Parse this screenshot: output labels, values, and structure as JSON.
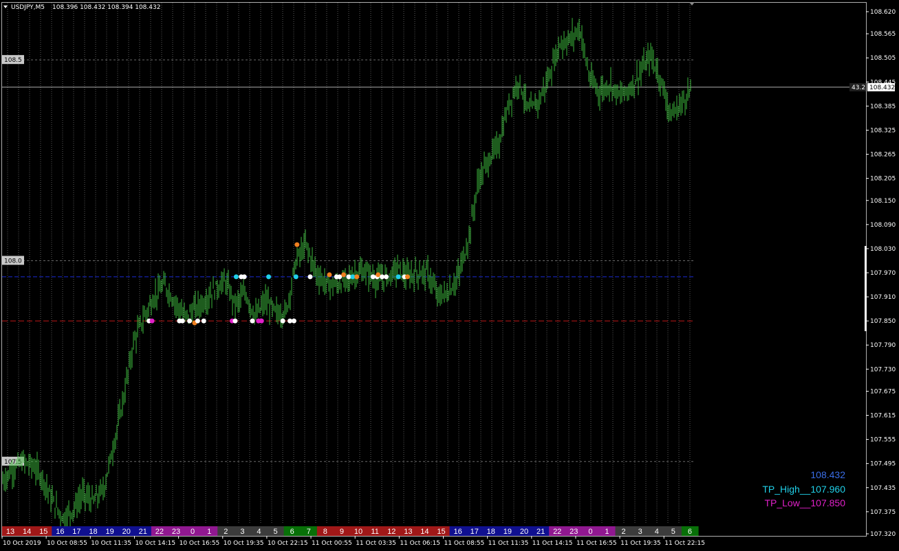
{
  "header": {
    "symbol": "USDJPY,M5",
    "ohlc": "108.396 108.432 108.394 108.432"
  },
  "chart_data": {
    "type": "bar",
    "title": "USDJPY,M5",
    "bar_color": "#3cb83c",
    "background": "#000000",
    "ylim": [
      107.3,
      108.65
    ],
    "price_ticks": [
      "108.620",
      "108.565",
      "108.505",
      "108.445",
      "108.385",
      "108.325",
      "108.265",
      "108.205",
      "108.150",
      "108.090",
      "108.030",
      "107.970",
      "107.910",
      "107.850",
      "107.790",
      "107.730",
      "107.675",
      "107.615",
      "107.555",
      "107.495",
      "107.435",
      "107.375",
      "107.320"
    ],
    "round_levels": [
      "108.5",
      "108.0",
      "107.5"
    ],
    "current_price": "108.432",
    "current_price_marker": "43.2",
    "levels": [
      {
        "name": "TP_High",
        "value": 107.96,
        "color": "#1a2ad8"
      },
      {
        "name": "TP_Low",
        "value": 107.85,
        "color": "#c01818"
      }
    ],
    "close_path": [
      [
        0,
        107.45
      ],
      [
        1,
        107.48
      ],
      [
        2,
        107.5
      ],
      [
        3,
        107.49
      ],
      [
        4,
        107.46
      ],
      [
        5,
        107.4
      ],
      [
        6,
        107.36
      ],
      [
        7,
        107.38
      ],
      [
        8,
        107.42
      ],
      [
        9,
        107.4
      ],
      [
        10,
        107.43
      ],
      [
        11,
        107.54
      ],
      [
        12,
        107.66
      ],
      [
        13,
        107.8
      ],
      [
        14,
        107.86
      ],
      [
        15,
        107.91
      ],
      [
        16,
        107.94
      ],
      [
        17,
        107.9
      ],
      [
        18,
        107.86
      ],
      [
        19,
        107.88
      ],
      [
        20,
        107.9
      ],
      [
        21,
        107.93
      ],
      [
        22,
        107.95
      ],
      [
        23,
        107.89
      ],
      [
        24,
        107.92
      ],
      [
        25,
        107.86
      ],
      [
        26,
        107.9
      ],
      [
        27,
        107.87
      ],
      [
        28,
        107.87
      ],
      [
        29,
        108.0
      ],
      [
        30,
        108.04
      ],
      [
        31,
        107.97
      ],
      [
        32,
        107.94
      ],
      [
        33,
        107.94
      ],
      [
        34,
        107.95
      ],
      [
        35,
        107.97
      ],
      [
        36,
        107.97
      ],
      [
        37,
        107.95
      ],
      [
        38,
        107.96
      ],
      [
        39,
        107.98
      ],
      [
        40,
        107.96
      ],
      [
        41,
        107.97
      ],
      [
        42,
        107.97
      ],
      [
        43,
        107.91
      ],
      [
        44,
        107.92
      ],
      [
        45,
        107.96
      ],
      [
        46,
        108.05
      ],
      [
        47,
        108.2
      ],
      [
        48,
        108.25
      ],
      [
        49,
        108.29
      ],
      [
        50,
        108.39
      ],
      [
        51,
        108.45
      ],
      [
        52,
        108.37
      ],
      [
        53,
        108.4
      ],
      [
        54,
        108.46
      ],
      [
        55,
        108.54
      ],
      [
        56,
        108.55
      ],
      [
        57,
        108.58
      ],
      [
        58,
        108.45
      ],
      [
        59,
        108.42
      ],
      [
        60,
        108.44
      ],
      [
        61,
        108.41
      ],
      [
        62,
        108.43
      ],
      [
        63,
        108.47
      ],
      [
        64,
        108.51
      ],
      [
        65,
        108.45
      ],
      [
        66,
        108.36
      ],
      [
        67,
        108.39
      ],
      [
        68,
        108.43
      ]
    ],
    "markers": [
      {
        "bar": 14.5,
        "price": 107.85,
        "color": "#ffffff"
      },
      {
        "bar": 14.8,
        "price": 107.85,
        "color": "#e020c8"
      },
      {
        "bar": 17.5,
        "price": 107.85,
        "color": "#ffffff"
      },
      {
        "bar": 17.8,
        "price": 107.85,
        "color": "#ffffff"
      },
      {
        "bar": 18.5,
        "price": 107.85,
        "color": "#ffffff"
      },
      {
        "bar": 19.0,
        "price": 107.845,
        "color": "#f08020"
      },
      {
        "bar": 19.3,
        "price": 107.85,
        "color": "#ffffff"
      },
      {
        "bar": 19.9,
        "price": 107.85,
        "color": "#ffffff"
      },
      {
        "bar": 22.7,
        "price": 107.85,
        "color": "#e020c8"
      },
      {
        "bar": 23.0,
        "price": 107.85,
        "color": "#ffffff"
      },
      {
        "bar": 23.1,
        "price": 107.96,
        "color": "#20d0e8"
      },
      {
        "bar": 23.6,
        "price": 107.96,
        "color": "#ffffff"
      },
      {
        "bar": 23.9,
        "price": 107.96,
        "color": "#ffffff"
      },
      {
        "bar": 24.7,
        "price": 107.85,
        "color": "#ffffff"
      },
      {
        "bar": 25.3,
        "price": 107.85,
        "color": "#e020c8"
      },
      {
        "bar": 25.6,
        "price": 107.85,
        "color": "#e020c8"
      },
      {
        "bar": 26.3,
        "price": 107.96,
        "color": "#20d0e8"
      },
      {
        "bar": 27.7,
        "price": 107.85,
        "color": "#ffffff"
      },
      {
        "bar": 28.4,
        "price": 107.85,
        "color": "#ffffff"
      },
      {
        "bar": 28.8,
        "price": 107.85,
        "color": "#ffffff"
      },
      {
        "bar": 29.0,
        "price": 107.96,
        "color": "#20d0e8"
      },
      {
        "bar": 29.1,
        "price": 108.04,
        "color": "#f08020"
      },
      {
        "bar": 30.4,
        "price": 107.96,
        "color": "#ffffff"
      },
      {
        "bar": 32.3,
        "price": 107.965,
        "color": "#f08020"
      },
      {
        "bar": 33.0,
        "price": 107.96,
        "color": "#ffffff"
      },
      {
        "bar": 33.3,
        "price": 107.96,
        "color": "#ffffff"
      },
      {
        "bar": 33.7,
        "price": 107.965,
        "color": "#f08020"
      },
      {
        "bar": 34.2,
        "price": 107.96,
        "color": "#ffffff"
      },
      {
        "bar": 34.6,
        "price": 107.96,
        "color": "#20d0e8"
      },
      {
        "bar": 35.0,
        "price": 107.96,
        "color": "#f08020"
      },
      {
        "bar": 36.6,
        "price": 107.96,
        "color": "#ffffff"
      },
      {
        "bar": 37.0,
        "price": 107.96,
        "color": "#ffffff"
      },
      {
        "bar": 37.1,
        "price": 107.965,
        "color": "#f08020"
      },
      {
        "bar": 37.5,
        "price": 107.96,
        "color": "#ffffff"
      },
      {
        "bar": 37.9,
        "price": 107.96,
        "color": "#ffffff"
      },
      {
        "bar": 39.1,
        "price": 107.96,
        "color": "#20d0e8"
      },
      {
        "bar": 39.7,
        "price": 107.96,
        "color": "#ffffff"
      },
      {
        "bar": 40.0,
        "price": 107.96,
        "color": "#f08020"
      }
    ],
    "hour_cells": [
      {
        "label": "13",
        "color": "#a01818"
      },
      {
        "label": "14",
        "color": "#a01818"
      },
      {
        "label": "15",
        "color": "#a01818"
      },
      {
        "label": "16",
        "color": "#101090"
      },
      {
        "label": "17",
        "color": "#101090"
      },
      {
        "label": "18",
        "color": "#101090"
      },
      {
        "label": "19",
        "color": "#101090"
      },
      {
        "label": "20",
        "color": "#101090"
      },
      {
        "label": "21",
        "color": "#101090"
      },
      {
        "label": "22",
        "color": "#901890"
      },
      {
        "label": "23",
        "color": "#901890"
      },
      {
        "label": "0",
        "color": "#901890"
      },
      {
        "label": "1",
        "color": "#901890"
      },
      {
        "label": "2",
        "color": "#3c3c3c"
      },
      {
        "label": "3",
        "color": "#3c3c3c"
      },
      {
        "label": "4",
        "color": "#3c3c3c"
      },
      {
        "label": "5",
        "color": "#3c3c3c"
      },
      {
        "label": "6",
        "color": "#087008"
      },
      {
        "label": "7",
        "color": "#087008"
      },
      {
        "label": "8",
        "color": "#a01818"
      },
      {
        "label": "9",
        "color": "#a01818"
      },
      {
        "label": "10",
        "color": "#a01818"
      },
      {
        "label": "11",
        "color": "#a01818"
      },
      {
        "label": "12",
        "color": "#a01818"
      },
      {
        "label": "13",
        "color": "#a01818"
      },
      {
        "label": "14",
        "color": "#a01818"
      },
      {
        "label": "15",
        "color": "#a01818"
      },
      {
        "label": "16",
        "color": "#101090"
      },
      {
        "label": "17",
        "color": "#101090"
      },
      {
        "label": "18",
        "color": "#101090"
      },
      {
        "label": "19",
        "color": "#101090"
      },
      {
        "label": "20",
        "color": "#101090"
      },
      {
        "label": "21",
        "color": "#101090"
      },
      {
        "label": "22",
        "color": "#901890"
      },
      {
        "label": "23",
        "color": "#901890"
      },
      {
        "label": "0",
        "color": "#901890"
      },
      {
        "label": "1",
        "color": "#901890"
      },
      {
        "label": "2",
        "color": "#3c3c3c"
      },
      {
        "label": "3",
        "color": "#3c3c3c"
      },
      {
        "label": "4",
        "color": "#3c3c3c"
      },
      {
        "label": "5",
        "color": "#3c3c3c"
      },
      {
        "label": "6",
        "color": "#087008"
      }
    ],
    "time_labels": [
      "10 Oct 2019",
      "10 Oct 08:55",
      "10 Oct 11:35",
      "10 Oct 14:15",
      "10 Oct 16:55",
      "10 Oct 19:35",
      "10 Oct 22:15",
      "11 Oct 00:55",
      "11 Oct 03:35",
      "11 Oct 06:15",
      "11 Oct 08:55",
      "11 Oct 11:35",
      "11 Oct 14:15",
      "11 Oct 16:55",
      "11 Oct 19:35",
      "11 Oct 22:15"
    ]
  },
  "info_panel": {
    "price": "108.432",
    "tp_high": "TP_High__107.960",
    "tp_low": "TP_Low__107.850",
    "price_color": "#3a6ee8",
    "tp_high_color": "#20d0e8",
    "tp_low_color": "#e020c8"
  }
}
